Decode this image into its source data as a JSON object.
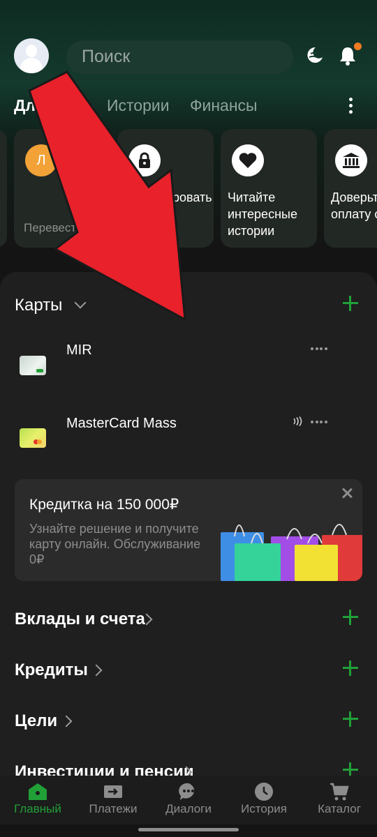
{
  "search": {
    "placeholder": "Поиск"
  },
  "tabs": [
    {
      "label": "Для вас"
    },
    {
      "label": "Истории"
    },
    {
      "label": "Финансы"
    }
  ],
  "stories": [
    {
      "icon": "letter-avatar",
      "avatar_letter": "Л",
      "text": "",
      "subtext": "Перевести"
    },
    {
      "icon": "lock-icon",
      "text": "Заблокировать",
      "subtext": ""
    },
    {
      "icon": "heart-icon",
      "text": "Читайте интересные истории",
      "subtext": ""
    },
    {
      "icon": "bank-icon",
      "text": "Доверьте нам оплату счетов",
      "subtext": ""
    }
  ],
  "cards_section": {
    "title": "Карты"
  },
  "cards": [
    {
      "name": "MIR"
    },
    {
      "name": "MasterCard Mass"
    }
  ],
  "promo": {
    "title": "Кредитка на 150 000₽",
    "description": "Узнайте решение и получите карту онлайн. Обслуживание 0₽"
  },
  "sections": [
    {
      "title": "Вклады и счета"
    },
    {
      "title": "Кредиты"
    },
    {
      "title": "Цели"
    },
    {
      "title": "Инвестиции и пенсии"
    }
  ],
  "bottom_nav": [
    {
      "label": "Главный",
      "icon": "home-icon",
      "active": true
    },
    {
      "label": "Платежи",
      "icon": "payments-icon",
      "active": false
    },
    {
      "label": "Диалоги",
      "icon": "chat-icon",
      "active": false
    },
    {
      "label": "История",
      "icon": "clock-icon",
      "active": false
    },
    {
      "label": "Каталог",
      "icon": "cart-icon",
      "active": false
    }
  ],
  "colors": {
    "accent": "#21a038",
    "notification": "#f07a22",
    "overlay_arrow": "#e8212b"
  }
}
